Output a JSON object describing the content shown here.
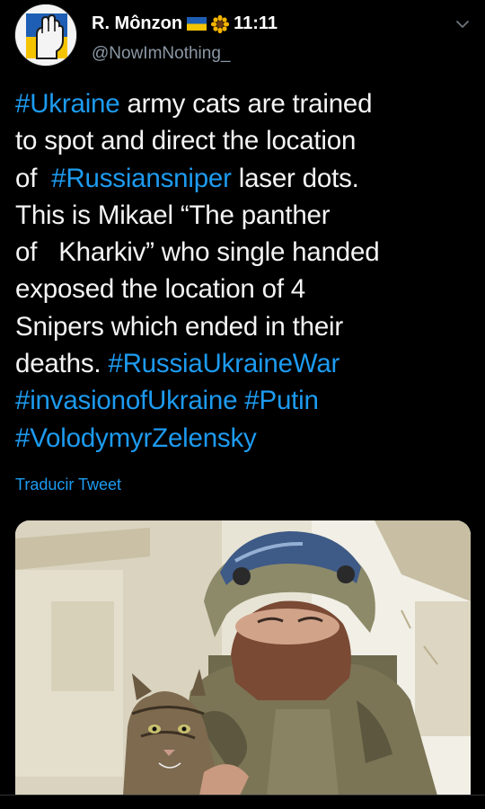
{
  "author": {
    "name": "R. Mônzon",
    "handle": "@NowImNothing_",
    "time": "11:11",
    "avatar_icon": "raised-fist-icon",
    "flag_icon": "ukraine-flag-icon",
    "sunflower_icon": "sunflower-icon"
  },
  "tweet": {
    "lines": [
      [
        {
          "t": "#Ukraine",
          "tag": true
        },
        {
          "t": " army cats are trained",
          "tag": false
        }
      ],
      [
        {
          "t": "to spot and direct the location",
          "tag": false
        }
      ],
      [
        {
          "t": "of  ",
          "tag": false
        },
        {
          "t": "#Russiansniper",
          "tag": true
        },
        {
          "t": " laser dots.",
          "tag": false
        }
      ],
      [
        {
          "t": "This is Mikael “The panther",
          "tag": false
        }
      ],
      [
        {
          "t": "of   Kharkiv” who single handed",
          "tag": false
        }
      ],
      [
        {
          "t": "exposed the location of 4",
          "tag": false
        }
      ],
      [
        {
          "t": "Snipers which ended in their",
          "tag": false
        }
      ],
      [
        {
          "t": "deaths. ",
          "tag": false
        },
        {
          "t": "#RussiaUkraineWar",
          "tag": true
        }
      ],
      [
        {
          "t": "#invasionofUkraine",
          "tag": true
        },
        {
          "t": " ",
          "tag": false
        },
        {
          "t": "#Putin",
          "tag": true
        }
      ],
      [
        {
          "t": "#VolodymyrZelensky",
          "tag": true
        }
      ]
    ],
    "translate_label": "Traducir Tweet"
  },
  "colors": {
    "background": "#000000",
    "link": "#1d9bf0",
    "secondary_text": "#8b98a5"
  },
  "media": {
    "description_icon": "photo-soldier-with-cat"
  }
}
